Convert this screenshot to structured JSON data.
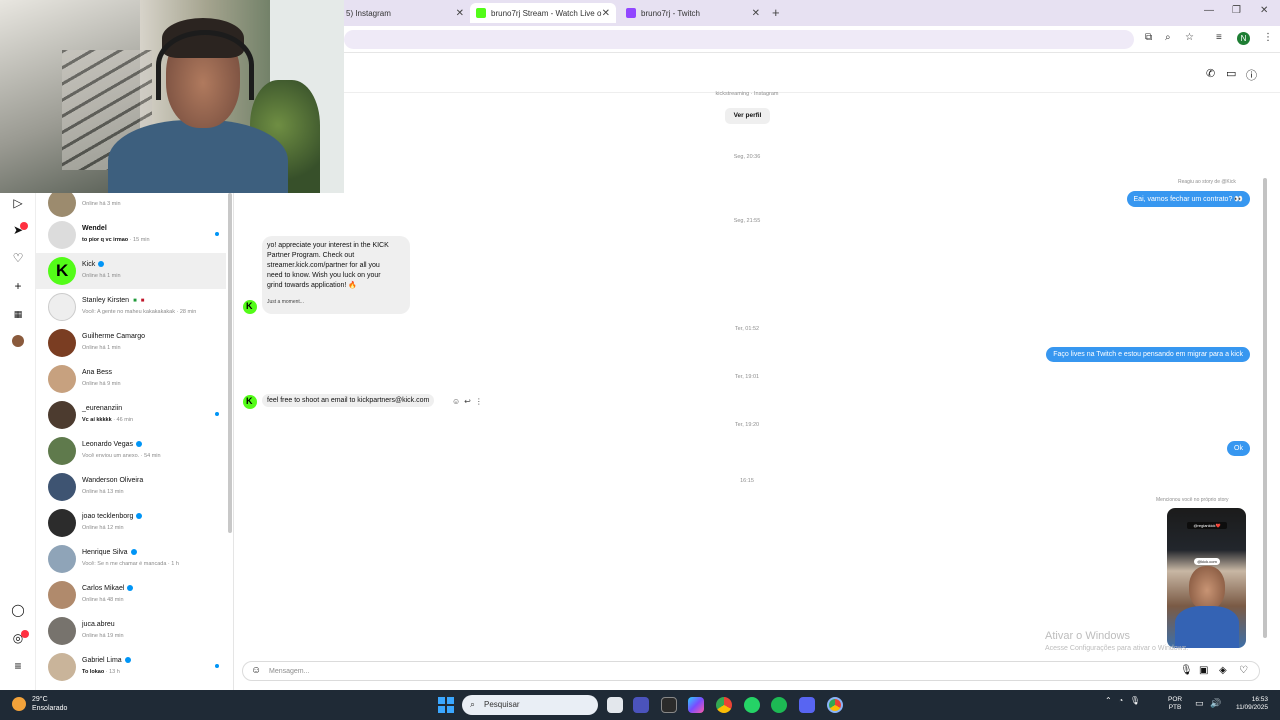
{
  "browser": {
    "tabs": [
      {
        "label": "5) Instagram",
        "close": "✕"
      },
      {
        "label": "bruno7rj Stream - Watch Live o",
        "close": "✕"
      },
      {
        "label": "bruno7rj - Twitch",
        "close": "✕"
      }
    ],
    "new_tab": "+",
    "window_controls": [
      "—",
      "❐",
      "✕"
    ],
    "profile_initial": "N"
  },
  "chat_header": {
    "subtitle": "kickstreaming · Instagram",
    "view_profile": "Ver perfil"
  },
  "sidebar": {
    "conversations": [
      {
        "name": "",
        "sub": "Online há 3 min",
        "unread": false
      },
      {
        "name": "Wendel",
        "sub_bold": "to pior q vc irmao",
        "sub": " · 15 min",
        "unread": true
      },
      {
        "name": "Kick",
        "verified": true,
        "sub": "Online há 1 min",
        "active": true
      },
      {
        "name": "Stanley Kirsten",
        "sub": "Você: A gente no maheu kakakakakak · 28 min"
      },
      {
        "name": "Guilherme Camargo",
        "sub": "Online há 1 min"
      },
      {
        "name": "Ana Bess",
        "sub": "Online há 9 min"
      },
      {
        "name": "_eurenanziin",
        "sub_bold": "Vc aí kkkkk",
        "sub": " · 46 min",
        "unread": true
      },
      {
        "name": "Leonardo Vegas",
        "verified": true,
        "sub": "Você enviou um anexo. · 54 min"
      },
      {
        "name": "Wanderson Oliveira",
        "sub": "Online há 13 min"
      },
      {
        "name": "joao tecklenborg",
        "verified": true,
        "sub": "Online há 12 min"
      },
      {
        "name": "Henrique Silva",
        "verified": true,
        "sub": "Você: Se n me chamar é mancada · 1 h"
      },
      {
        "name": "Carlos Mikael",
        "verified": true,
        "sub": "Online há 48 min"
      },
      {
        "name": "juca.abreu",
        "sub": "Online há 19 min"
      },
      {
        "name": "Gabriel Lima",
        "verified": true,
        "sub_bold": "To lokao",
        "sub": " · 13 h",
        "unread": true
      }
    ]
  },
  "messages": {
    "time_1": "Seg, 20:36",
    "story_reply_label": "Reagiu ao story de @Kick",
    "out_1": "Eai, vamos fechar um contrato? 👀",
    "time_2": "Seg, 21:55",
    "in_1_lines": [
      "yo! appreciate your interest in the KICK",
      "Partner Program. Check out",
      "streamer.kick.com/partner for all you",
      "need to know. Wish you luck on your",
      "grind towards application! 🔥"
    ],
    "in_1_status": "Just a moment...",
    "time_3": "Ter, 01:52",
    "out_2": "Faço lives na Twitch e estou pensando em migrar para a kick",
    "time_4": "Ter, 19:01",
    "in_2": "feel free to shoot an email to kickpartners@kick.com",
    "time_5": "Ter, 19:20",
    "out_3": "Ok",
    "time_6": "16:15",
    "mention_label": "Mencionou você no próprio story",
    "story_tag": "@regiankick❤️",
    "story_kick": "@kick.com"
  },
  "composer": {
    "placeholder": "Mensagem..."
  },
  "watermark": {
    "title": "Ativar o Windows",
    "subtitle": "Acesse Configurações para ativar o Windows."
  },
  "taskbar": {
    "temperature": "29°C",
    "weather": "Ensolarado",
    "search": "Pesquisar",
    "lang_1": "POR",
    "lang_2": "PTB",
    "time": "16:53",
    "date": "11/09/2025"
  },
  "colors": {
    "instagram_blue": "#3797f0",
    "kick_green": "#53fc18",
    "taskbar_bg": "#1f2a36"
  }
}
